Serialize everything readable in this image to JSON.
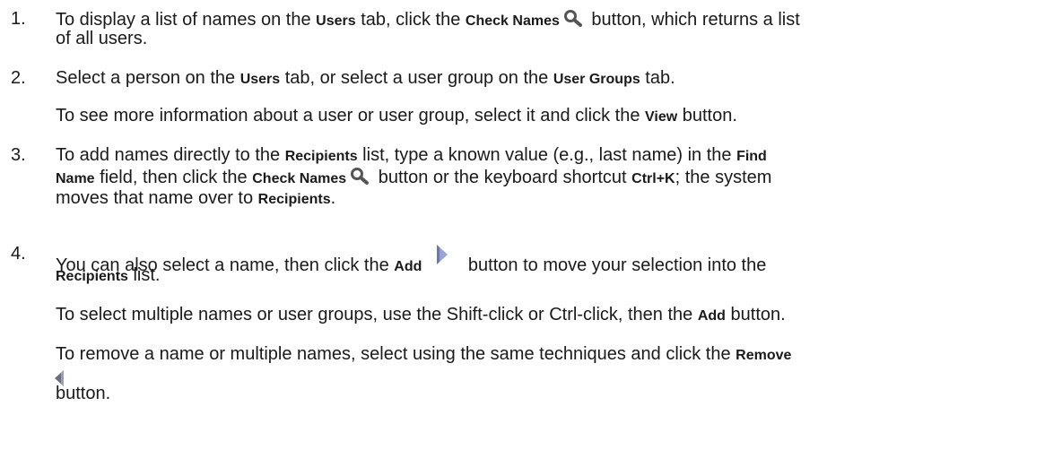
{
  "step1": {
    "number": "1.",
    "t1": "To display a list of names on the ",
    "b_users": "Users",
    "t2": " tab, click the ",
    "b_check_names": "Check Names",
    "t3": " button, which returns a list",
    "t4": "of all users."
  },
  "step2": {
    "number": "2.",
    "t1": "Select a person on the ",
    "b_users": "Users",
    "t2": " tab, or select a user group on the ",
    "b_user_groups": "User Groups",
    "t3": " tab.",
    "t4": "To see more information about a user or user group, select it and click the ",
    "b_view": "View",
    "t5": " button."
  },
  "step3": {
    "number": "3.",
    "t1": "To add names directly to the ",
    "b_recipients": "Recipients",
    "t2": " list, type a known value (e.g., last name) in the ",
    "b_find": "Find",
    "b_name": "Name",
    "t3": " field, then click the ",
    "b_check_names": "Check Names",
    "t4": " button or the keyboard shortcut ",
    "b_ctrlk": "Ctrl+K",
    "t5": "; the system",
    "t6": "moves that name over to ",
    "b_recipients2": "Recipients",
    "t7": "."
  },
  "step4": {
    "number": "4.",
    "t1": "You can also select a name, then click the ",
    "b_add": "Add",
    "t2": " button to move your selection into the",
    "b_recipients": "Recipients",
    "t3": " list.",
    "t4": "To select multiple names or user groups, use the Shift-click or Ctrl-click, then the ",
    "b_add2": "Add",
    "t5": " button.",
    "t6": "To remove a name or multiple names, select using the same techniques and click the ",
    "b_remove": "Remove",
    "t7": "button."
  },
  "icons": {
    "search": "search-icon",
    "add": "add-arrow-icon",
    "remove": "remove-arrow-icon",
    "search_color": "#555555",
    "add_color": "#9aa3d6",
    "remove_color": "#6b6f7d"
  }
}
